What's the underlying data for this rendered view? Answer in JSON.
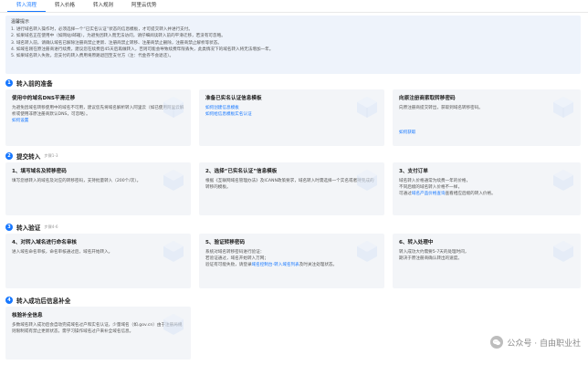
{
  "tabs": [
    {
      "label": "转入流程",
      "active": true
    },
    {
      "label": "转入价格",
      "active": false
    },
    {
      "label": "转入规则",
      "active": false
    },
    {
      "label": "阿里云优势",
      "active": false
    }
  ],
  "notice": {
    "title": "温馨提示",
    "lines": [
      "1. 进行域名转入操作时，必须选择一个“已实名认证”状态的信息模板，才可提交转入并进行支付。",
      "2. 如果域名正在使用中（如网站/邮箱），为避免因转入而无法访问，请仔细阅读转入前的平滑迁移，若没有可忽略。",
      "3. 域名转入前，请确认域名已解除注册商禁止更新、注册商禁止转移、注册商禁止删除，注册商禁止解析等状态。",
      "4. 如域名刚在原注册商进行续费，建议您在续费后45天后再做转入，否则可能会导致续费年限丢失，此类情况下的域名转入将无法增加一年。",
      "5. 如果域名转入失败，您支付的转入费用将原路退回至支付方（注：代金券不会退还）。"
    ]
  },
  "steps": [
    {
      "num": "1",
      "title": "转入前的准备",
      "sub": ""
    },
    {
      "num": "2",
      "title": "提交转入",
      "sub": "步骤1-3"
    },
    {
      "num": "3",
      "title": "转入验证",
      "sub": "步骤4-6"
    },
    {
      "num": "4",
      "title": "转入成功后信息补全",
      "sub": ""
    }
  ],
  "cards": {
    "prep1": {
      "title": "使用中的域名DNS平滑迁移",
      "text": "为避免因域名转移使用中的域名不可用，建议您先将域名解析转入阿里云（如已使用阿里云解析或使用非原注册商默认DNS，可忽略）。",
      "link": "如何设置"
    },
    "prep2": {
      "title": "准备已实名认证信息模板",
      "link1": "如何创建信息模板",
      "link2": "如何给信息模板实名认证"
    },
    "prep3": {
      "title": "向原注册商索取转移密码",
      "text": "向原注册商提交转出，获取到域名转移密码。",
      "link": "如何获取"
    },
    "s1": {
      "title": "1、填写域名及转移密码",
      "text": "填写您想转入的域名及对应的转移密码，支持批量转入（200个/次）。"
    },
    "s2": {
      "title": "2、选择“已实名认证”信息模板",
      "text": "根据《互联网域名管理办法》及ICANN政策要求，域名转入时需选择一个实名或者持完成的转移的模板。"
    },
    "s3": {
      "title": "3、支付订单",
      "text1": "域名转入价格通常为续费一年的价格，",
      "text2": "不同后缀的域名转入价格不一样，",
      "text3_pre": "可通过",
      "text3_link": "域名产品价格查询",
      "text3_post": "查看相应后缀的转入价格。"
    },
    "s4": {
      "title": "4、对转入域名进行命名审核",
      "text": "进入域名命名审核，命名审核通过后，域名开始转入。"
    },
    "s5": {
      "title": "5、验证转移密码",
      "text1": "系统对域名转移密码进行验证：",
      "text2": "若验证通过，域名开始转入万网；",
      "text3_pre": "验证有可能失败，请登录",
      "text3_link": "域名控制台-转入域名列表",
      "text3_post": "及时关注处理状态。"
    },
    "s6": {
      "title": "6、转入处理中",
      "text1": "转入成功大约需要5-7天的处理时间，",
      "text2": "期决于原注册商确认转出的速度。"
    },
    "post": {
      "title": "核验补全信息",
      "text": "多数域名转入成功后会自动完成域名过户和实名认证，少量域名（如.gov.cn）由于注册局规则限制或有禁止更新状态，需学习操作域名过户来补全域名信息。"
    }
  },
  "watermark": {
    "text": "公众号 · 自由职业社"
  }
}
